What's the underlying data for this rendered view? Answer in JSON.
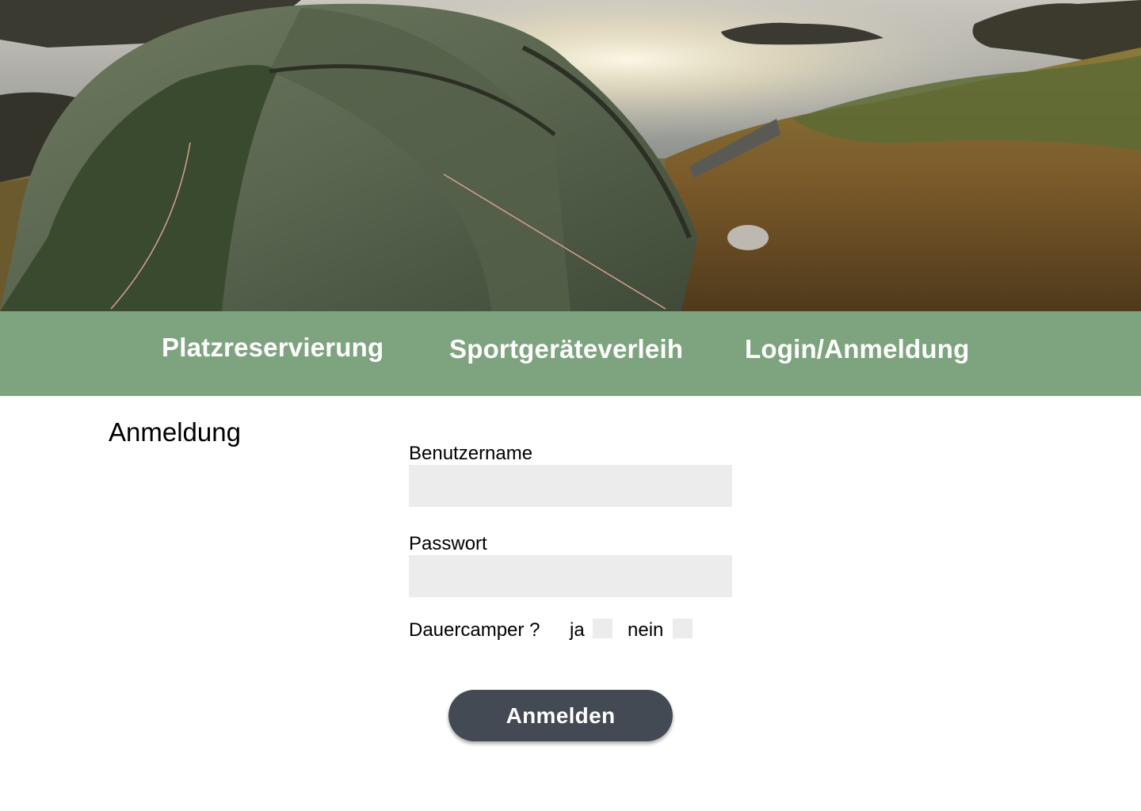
{
  "hero": {
    "image_description_icon": "camping-tent-photo"
  },
  "nav": {
    "items": [
      {
        "label": "Platzreservierung"
      },
      {
        "label": "Sportgeräteverleih"
      },
      {
        "label": "Login/Anmeldung"
      }
    ],
    "background": "#7ea47f"
  },
  "form": {
    "title": "Anmeldung",
    "username_label": "Benutzername",
    "username_value": "",
    "password_label": "Passwort",
    "password_value": "",
    "dauercamper_label": "Dauercamper ?",
    "option_yes": "ja",
    "option_no": "nein",
    "submit_label": "Anmelden"
  },
  "colors": {
    "button": "#434a54",
    "field": "#ececec"
  }
}
